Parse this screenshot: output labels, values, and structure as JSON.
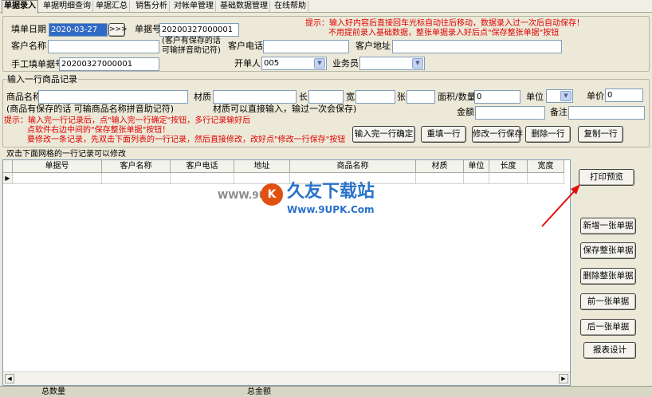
{
  "tabs": [
    "单据录入",
    "单据明细查询",
    "单据汇总",
    "销售分析",
    "对帐单管理",
    "基础数据管理",
    "在线帮助"
  ],
  "header": {
    "date_label": "填单日期",
    "date_value": "2020-03-27",
    "date_btn": ">>>",
    "no_label": "单据号",
    "no_value": "20200327000001",
    "hint1": "提示：输入好内容后直接回车光标自动往后移动，数据录入过一次后自动保存！",
    "hint2": "不用提前录入基础数据，整张单据录入好后点\"保存整张单据\"按钮",
    "customer_label": "客户名称",
    "customer_note1": "(客户有保存的话",
    "customer_note2": "可输拼音助记符)",
    "phone_label": "客户电话",
    "address_label": "客户地址",
    "manual_label": "手工填单据号",
    "manual_value": "20200327000001",
    "opener_label": "开单人",
    "opener_value": "005",
    "sales_label": "业务员"
  },
  "entry": {
    "group_title": "输入一行商品记录",
    "product_label": "商品名称",
    "product_note": "(商品有保存的话  可输商品名称拼音助记符)",
    "material_label": "材质",
    "material_note": "材质可以直接输入，输过一次会保存)",
    "len_label": "长",
    "wid_label": "宽",
    "sheet_label": "张",
    "area_label": "面积/数量",
    "area_value": "0",
    "unit_label": "单位",
    "price_label": "单价",
    "price_value": "0",
    "amount_label": "金额",
    "remark_label": "备注",
    "hint1": "提示：输入完一行记录后，点\"输入完一行确定\"按钮，多行记录输好后",
    "hint2": "点软件右边中间的\"保存整张单据\"按钮！",
    "hint3": "要修改一条记录，先双击下面列表的一行记录，然后直接修改，改好点\"修改一行保存\"按钮",
    "buttons": [
      "输入完一行确定",
      "重填一行",
      "修改一行保存",
      "删除一行",
      "复制一行"
    ]
  },
  "grid": {
    "caption": "双击下面网格的一行记录可以修改",
    "columns": [
      "单据号",
      "客户名称",
      "客户电话",
      "地址",
      "商品名称",
      "材质",
      "单位",
      "长度",
      "宽度"
    ],
    "watermark_title": "久友下载站",
    "watermark_url": "Www.9UPK.Com",
    "watermark_left": "WWW.9U"
  },
  "side_buttons": [
    "打印预览",
    "新增一张单据",
    "保存整张单据",
    "删除整张单据",
    "前一张单据",
    "后一张单据",
    "报表设计"
  ],
  "status": {
    "total_qty": "总数量",
    "total_amount": "总金额"
  },
  "colors": {
    "hint": "#e00000",
    "arrow": "#e01010",
    "selected": "#316ac5"
  }
}
